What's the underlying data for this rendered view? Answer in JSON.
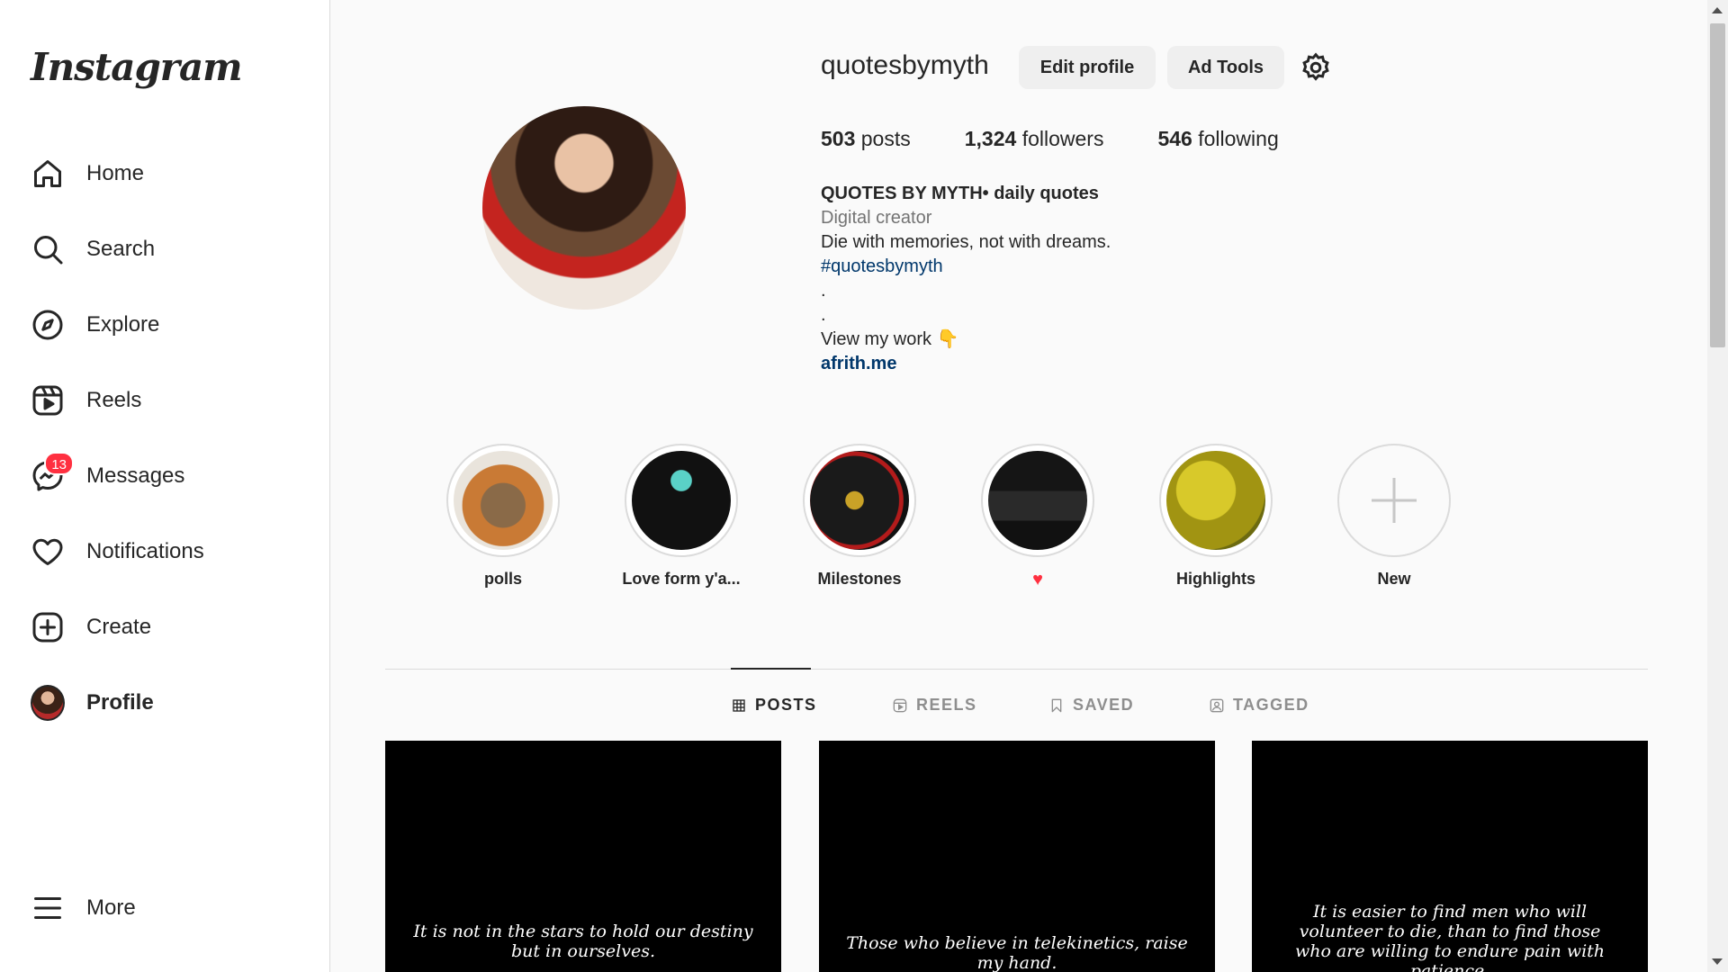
{
  "sidebar": {
    "logo": "Instagram",
    "items": [
      {
        "label": "Home",
        "icon": "home-icon"
      },
      {
        "label": "Search",
        "icon": "search-icon"
      },
      {
        "label": "Explore",
        "icon": "compass-icon"
      },
      {
        "label": "Reels",
        "icon": "reels-icon"
      },
      {
        "label": "Messages",
        "icon": "messenger-icon",
        "badge": "13"
      },
      {
        "label": "Notifications",
        "icon": "heart-icon"
      },
      {
        "label": "Create",
        "icon": "plus-square-icon"
      },
      {
        "label": "Profile",
        "icon": "avatar"
      }
    ],
    "more_label": "More"
  },
  "profile": {
    "username": "quotesbymyth",
    "edit_profile_label": "Edit profile",
    "ad_tools_label": "Ad Tools",
    "stats": {
      "posts_count": "503",
      "posts_label": "posts",
      "followers_count": "1,324",
      "followers_label": "followers",
      "following_count": "546",
      "following_label": "following"
    },
    "bio": {
      "name": "QUOTES BY MYTH• daily quotes",
      "category": "Digital creator",
      "line1": "Die with memories, not with dreams.",
      "hashtag": "#quotesbymyth",
      "dot1": ".",
      "dot2": ".",
      "view_work": "View my work 👇",
      "link": "afrith.me"
    }
  },
  "highlights": [
    {
      "label": "polls"
    },
    {
      "label": "Love form y'a..."
    },
    {
      "label": "Milestones"
    },
    {
      "label": "♥"
    },
    {
      "label": "Highlights"
    },
    {
      "label": "New"
    }
  ],
  "tabs": [
    {
      "label": "POSTS",
      "active": true
    },
    {
      "label": "REELS",
      "active": false
    },
    {
      "label": "SAVED",
      "active": false
    },
    {
      "label": "TAGGED",
      "active": false
    }
  ],
  "posts": [
    {
      "quote": "It is not in the stars to hold our destiny but in ourselves."
    },
    {
      "quote": "Those who believe in telekinetics, raise my hand."
    },
    {
      "quote": "It is easier to find men who will volunteer to die, than to find those who are willing to endure pain with patience."
    }
  ],
  "colors": {
    "badge": "#ff3040",
    "link": "#00376b",
    "muted": "#737373",
    "button_bg": "#efefef"
  }
}
